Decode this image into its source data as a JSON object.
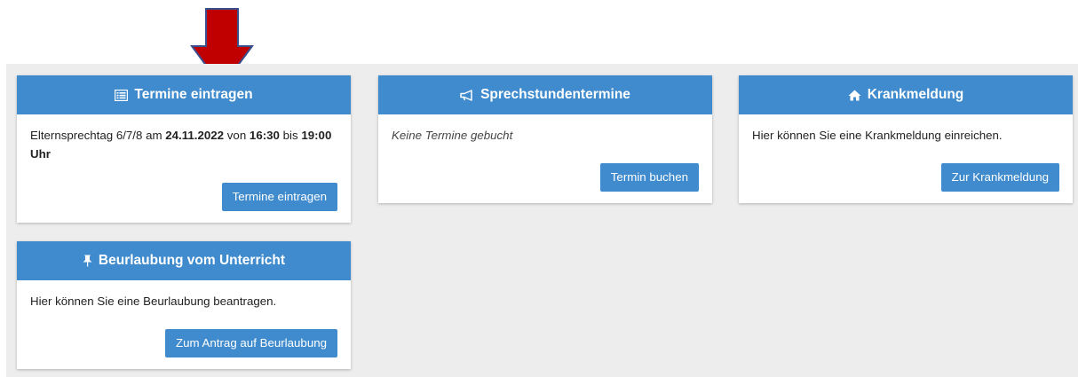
{
  "cards": {
    "termine": {
      "title": "Termine eintragen",
      "icon": "list-icon",
      "text_prefix": "Elternsprechtag 6/7/8 am ",
      "date": "24.11.2022",
      "text_mid1": " von ",
      "time_from": "16:30",
      "text_mid2": " bis ",
      "time_to": "19:00 Uhr",
      "button": "Termine eintragen"
    },
    "sprechstunden": {
      "title": "Sprechstundentermine",
      "icon": "megaphone-icon",
      "text": "Keine Termine gebucht",
      "button": "Termin buchen"
    },
    "krankmeldung": {
      "title": "Krankmeldung",
      "icon": "home-icon",
      "text": "Hier können Sie eine Krankmeldung einreichen.",
      "button": "Zur Krankmeldung"
    },
    "beurlaubung": {
      "title": "Beurlaubung vom Unterricht",
      "icon": "pin-icon",
      "text": "Hier können Sie eine Beurlaubung beantragen.",
      "button": "Zum Antrag auf Beurlaubung"
    }
  },
  "colors": {
    "header": "#3f8bcd",
    "button": "#3f8bcd",
    "background": "#ededed",
    "arrow": "#c00000"
  }
}
